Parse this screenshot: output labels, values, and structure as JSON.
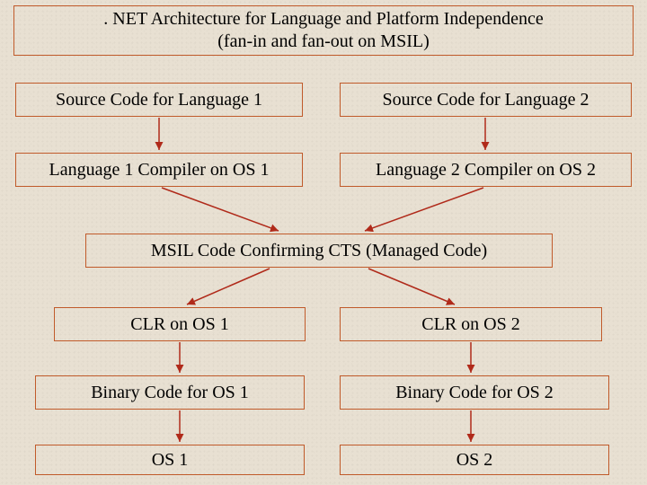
{
  "title": {
    "line1": ". NET Architecture for Language and Platform Independence",
    "line2": "(fan-in and fan-out on MSIL)"
  },
  "boxes": {
    "src1": "Source Code for Language 1",
    "src2": "Source Code for Language 2",
    "comp1": "Language 1 Compiler on OS 1",
    "comp2": "Language 2 Compiler on OS 2",
    "msil": "MSIL Code Confirming CTS (Managed Code)",
    "clr1": "CLR on OS 1",
    "clr2": "CLR on OS 2",
    "bin1": "Binary Code for OS 1",
    "bin2": "Binary Code for OS 2",
    "os1": "OS 1",
    "os2": "OS 2"
  }
}
